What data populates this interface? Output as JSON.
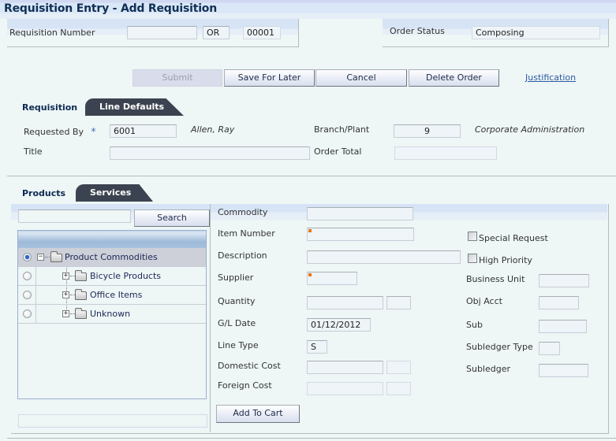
{
  "window": {
    "title": "Requisition Entry - Add Requisition"
  },
  "header": {
    "requisition_number_label": "Requisition Number",
    "requisition_number_value": "",
    "order_type_value": "OR",
    "company_value": "00001",
    "order_status_label": "Order Status",
    "order_status_value": "Composing"
  },
  "toolbar": {
    "submit_label": "Submit",
    "save_for_later_label": "Save For Later",
    "cancel_label": "Cancel",
    "delete_order_label": "Delete Order",
    "justification_link": "Justification"
  },
  "requisition_tabs": {
    "active": "Requisition",
    "inactive": "Line Defaults"
  },
  "requisition": {
    "requested_by_label": "Requested By",
    "required_marker": "*",
    "requested_by_value": "6001",
    "requested_by_name": "Allen, Ray",
    "branch_plant_label": "Branch/Plant",
    "branch_plant_value": "9",
    "branch_plant_name": "Corporate Administration",
    "title_label": "Title",
    "title_value": "",
    "order_total_label": "Order Total",
    "order_total_value": ""
  },
  "product_tabs": {
    "active": "Products",
    "inactive": "Services"
  },
  "search": {
    "input_value": "",
    "button_label": "Search"
  },
  "tree": {
    "root": {
      "label": "Product Commodities",
      "selected": true,
      "expanded": true
    },
    "children": [
      {
        "label": "Bicycle Products",
        "selected": false,
        "expanded": false
      },
      {
        "label": "Office Items",
        "selected": false,
        "expanded": false
      },
      {
        "label": "Unknown",
        "selected": false,
        "expanded": false
      }
    ]
  },
  "line_form": {
    "commodity_label": "Commodity",
    "commodity_value": "",
    "item_number_label": "Item Number",
    "item_number_value": "",
    "description_label": "Description",
    "description_value": "",
    "supplier_label": "Supplier",
    "supplier_value": "",
    "quantity_label": "Quantity",
    "quantity_value": "",
    "quantity_uom": "",
    "gl_date_label": "G/L Date",
    "gl_date_value": "01/12/2012",
    "line_type_label": "Line Type",
    "line_type_value": "S",
    "domestic_cost_label": "Domestic Cost",
    "domestic_cost_value": "",
    "domestic_currency": "",
    "foreign_cost_label": "Foreign Cost",
    "foreign_cost_value": "",
    "foreign_currency": "",
    "add_to_cart_label": "Add To Cart",
    "special_request_label": "Special Request",
    "special_request_checked": false,
    "high_priority_label": "High Priority",
    "high_priority_checked": false,
    "business_unit_label": "Business Unit",
    "business_unit_value": "",
    "obj_acct_label": "Obj Acct",
    "obj_acct_value": "",
    "sub_label": "Sub",
    "sub_value": "",
    "subledger_type_label": "Subledger Type",
    "subledger_type_value": "",
    "subledger_label": "Subledger",
    "subledger_value": ""
  },
  "colors": {
    "title_text": "#113055",
    "link": "#2b5aa3",
    "required_indicator": "#e8751a",
    "tab_dark": "#3c4350",
    "radio_selected": "#2a63c9"
  }
}
